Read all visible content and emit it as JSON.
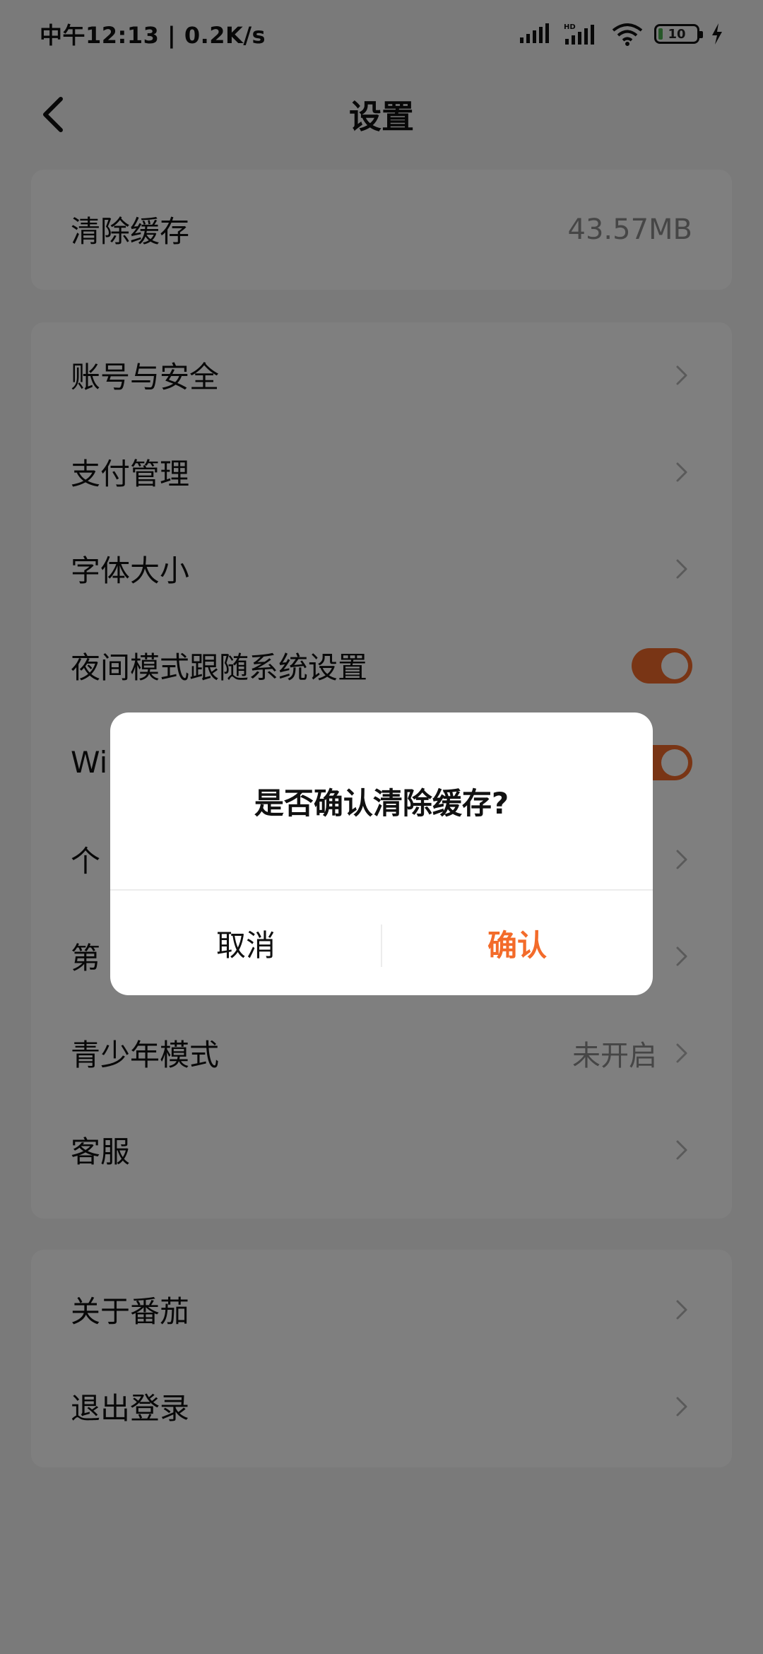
{
  "status_bar": {
    "time_speed": "中午12:13 | 0.2K/s",
    "battery_level": "10",
    "icons": [
      "signal-icon",
      "hd-signal-icon",
      "wifi-icon",
      "battery-icon",
      "charging-icon"
    ]
  },
  "header": {
    "title": "设置"
  },
  "cache_card": {
    "label": "清除缓存",
    "value": "43.57MB"
  },
  "settings_items": [
    {
      "label": "账号与安全"
    },
    {
      "label": "支付管理"
    },
    {
      "label": "字体大小"
    },
    {
      "label": "夜间模式跟随系统设置",
      "toggle": "on"
    },
    {
      "label": "Wi",
      "toggle": "on"
    },
    {
      "label": "个"
    },
    {
      "label": "第"
    },
    {
      "label": "青少年模式",
      "value": "未开启"
    },
    {
      "label": "客服"
    }
  ],
  "bottom_items": [
    {
      "label": "关于番茄"
    },
    {
      "label": "退出登录"
    }
  ],
  "dialog": {
    "title": "是否确认清除缓存?",
    "cancel_label": "取消",
    "confirm_label": "确认"
  },
  "colors": {
    "accent": "#f36b2a",
    "overlay": "rgba(0,0,0,0.5)",
    "background": "#f5f5f5"
  }
}
